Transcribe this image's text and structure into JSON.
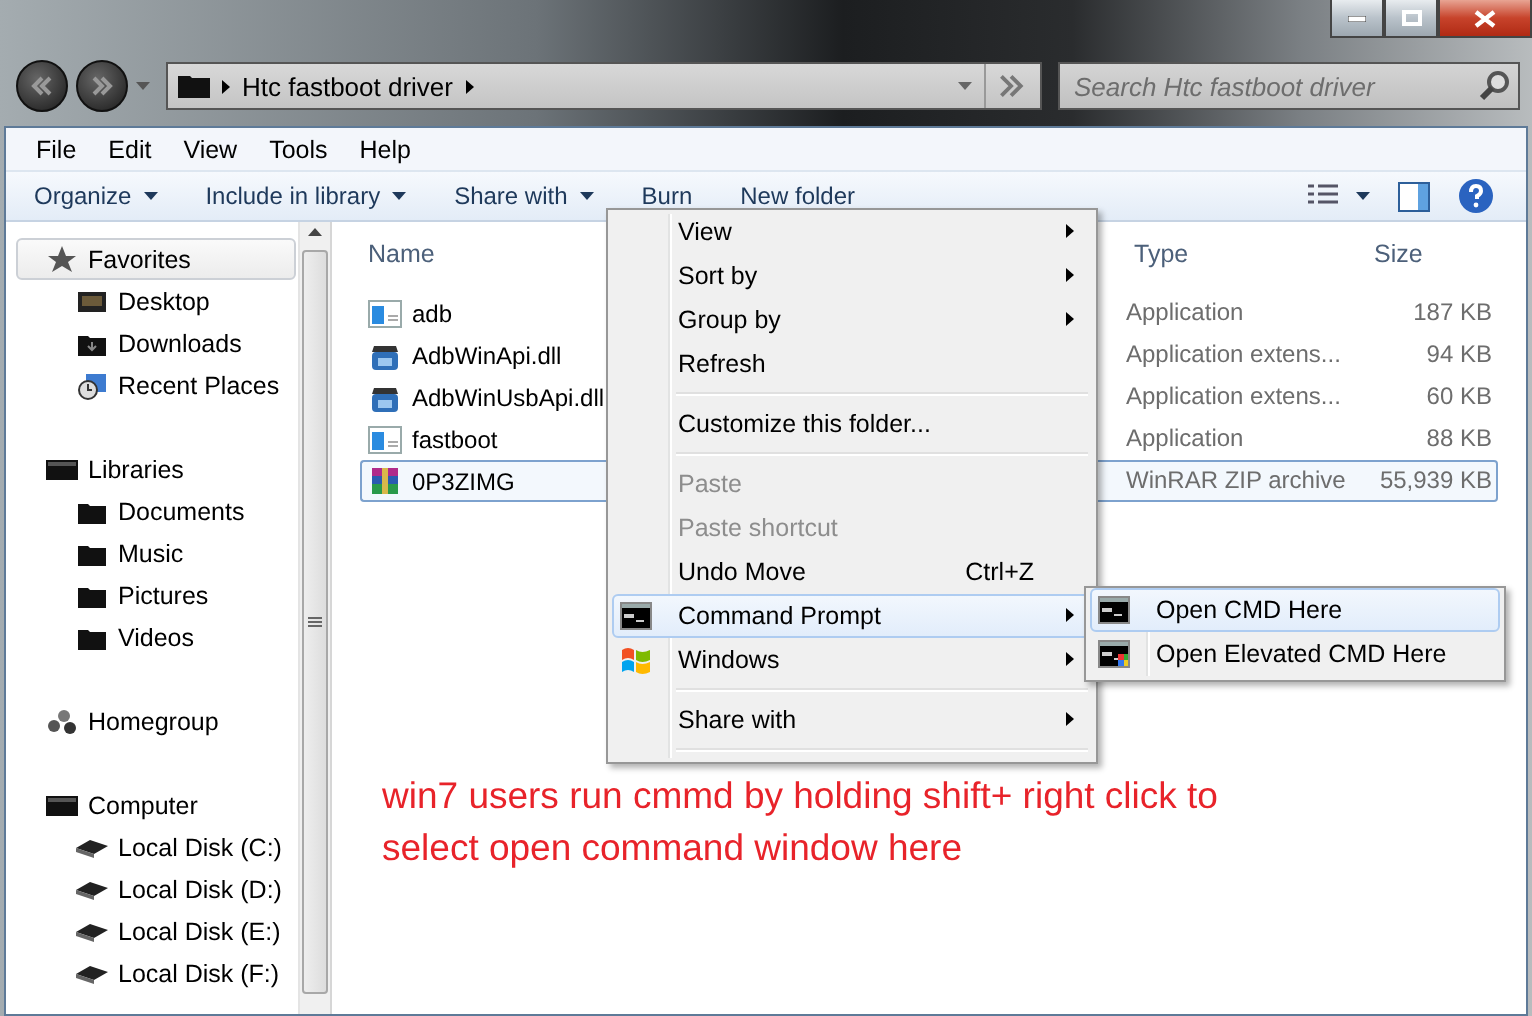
{
  "address": {
    "crumbs": [
      "Htc fastboot driver"
    ]
  },
  "search": {
    "placeholder": "Search Htc fastboot driver"
  },
  "menu_bar": [
    "File",
    "Edit",
    "View",
    "Tools",
    "Help"
  ],
  "toolbar": [
    {
      "label": "Organize",
      "dropdown": true
    },
    {
      "label": "Include in library",
      "dropdown": true
    },
    {
      "label": "Share with",
      "dropdown": true
    },
    {
      "label": "Burn",
      "dropdown": false
    },
    {
      "label": "New folder",
      "dropdown": false
    }
  ],
  "sidebar": [
    {
      "label": "Favorites",
      "kind": "star",
      "selected": true,
      "children": [
        {
          "label": "Desktop",
          "kind": "desktop",
          "selected": false
        },
        {
          "label": "Downloads",
          "kind": "downloads",
          "selected": false
        },
        {
          "label": "Recent Places",
          "kind": "recent",
          "selected": false
        }
      ]
    },
    {
      "label": "Libraries",
      "kind": "library",
      "selected": false,
      "children": [
        {
          "label": "Documents",
          "kind": "folder",
          "selected": false
        },
        {
          "label": "Music",
          "kind": "folder",
          "selected": false
        },
        {
          "label": "Pictures",
          "kind": "folder",
          "selected": false
        },
        {
          "label": "Videos",
          "kind": "folder",
          "selected": false
        }
      ]
    },
    {
      "label": "Homegroup",
      "kind": "homegroup",
      "selected": false
    },
    {
      "label": "Computer",
      "kind": "computer",
      "selected": false,
      "children": [
        {
          "label": "Local Disk (C:)",
          "kind": "drive",
          "selected": false
        },
        {
          "label": "Local Disk (D:)",
          "kind": "drive",
          "selected": false
        },
        {
          "label": "Local Disk (E:)",
          "kind": "drive",
          "selected": false
        },
        {
          "label": "Local Disk (F:)",
          "kind": "drive",
          "selected": false
        }
      ]
    }
  ],
  "file_list": {
    "columns": [
      "Name",
      "Type",
      "Size"
    ],
    "rows": [
      {
        "name": "adb",
        "type": "Application",
        "size": "187 KB",
        "kind": "app",
        "selected": false
      },
      {
        "name": "AdbWinApi.dll",
        "type": "Application extens...",
        "size": "94 KB",
        "kind": "dll",
        "selected": false
      },
      {
        "name": "AdbWinUsbApi.dll",
        "type": "Application extens...",
        "size": "60 KB",
        "kind": "dll",
        "selected": false
      },
      {
        "name": "fastboot",
        "type": "Application",
        "size": "88 KB",
        "kind": "app",
        "selected": false
      },
      {
        "name": "0P3ZIMG",
        "type": "WinRAR ZIP archive",
        "size": "55,939 KB",
        "kind": "archive",
        "selected": true
      }
    ]
  },
  "annotation": "win7 users run cmmd by holding shift+ right click to\nselect open command window here",
  "context_menu": [
    {
      "kind": "item",
      "label": "View",
      "submenu": true,
      "disabled": false,
      "selected": false
    },
    {
      "kind": "item",
      "label": "Sort by",
      "submenu": true,
      "disabled": false,
      "selected": false
    },
    {
      "kind": "item",
      "label": "Group by",
      "submenu": true,
      "disabled": false,
      "selected": false
    },
    {
      "kind": "item",
      "label": "Refresh",
      "submenu": false,
      "disabled": false,
      "selected": false
    },
    {
      "kind": "separator"
    },
    {
      "kind": "item",
      "label": "Customize this folder...",
      "submenu": false,
      "disabled": false,
      "selected": false
    },
    {
      "kind": "separator"
    },
    {
      "kind": "item",
      "label": "Paste",
      "submenu": false,
      "disabled": true,
      "selected": false
    },
    {
      "kind": "item",
      "label": "Paste shortcut",
      "submenu": false,
      "disabled": true,
      "selected": false
    },
    {
      "kind": "item",
      "label": "Undo Move",
      "shortcut": "Ctrl+Z",
      "submenu": false,
      "disabled": false,
      "selected": false
    },
    {
      "kind": "item",
      "label": "Command Prompt",
      "submenu": true,
      "disabled": false,
      "selected": true
    },
    {
      "kind": "item",
      "label": "Windows",
      "submenu": true,
      "disabled": false,
      "selected": false
    },
    {
      "kind": "separator"
    },
    {
      "kind": "item",
      "label": "Share with",
      "submenu": true,
      "disabled": false,
      "selected": false
    },
    {
      "kind": "separator"
    }
  ],
  "submenu": [
    {
      "label": "Open CMD Here",
      "selected": true
    },
    {
      "label": "Open Elevated CMD Here",
      "selected": false
    }
  ]
}
